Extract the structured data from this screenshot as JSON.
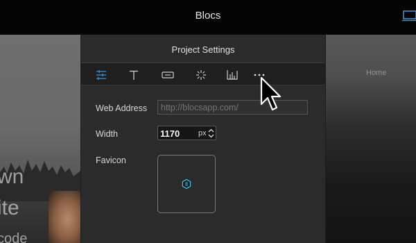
{
  "app": {
    "title": "Blocs"
  },
  "background": {
    "nav_home": "Home",
    "hero_lines": [
      "wn",
      "ite",
      "code"
    ]
  },
  "dialog": {
    "title": "Project Settings",
    "tabs": [
      {
        "icon": "sliders-icon"
      },
      {
        "icon": "text-icon"
      },
      {
        "icon": "button-icon"
      },
      {
        "icon": "loader-icon"
      },
      {
        "icon": "chart-icon"
      },
      {
        "icon": "more-icon"
      }
    ],
    "web_address": {
      "label": "Web Address",
      "placeholder": "http://blocsapp.com/"
    },
    "width": {
      "label": "Width",
      "value": "1170",
      "unit": "px"
    },
    "favicon": {
      "label": "Favicon"
    }
  },
  "colors": {
    "accent": "#3d8fd4",
    "favicon_cyan": "#34c2e0"
  }
}
